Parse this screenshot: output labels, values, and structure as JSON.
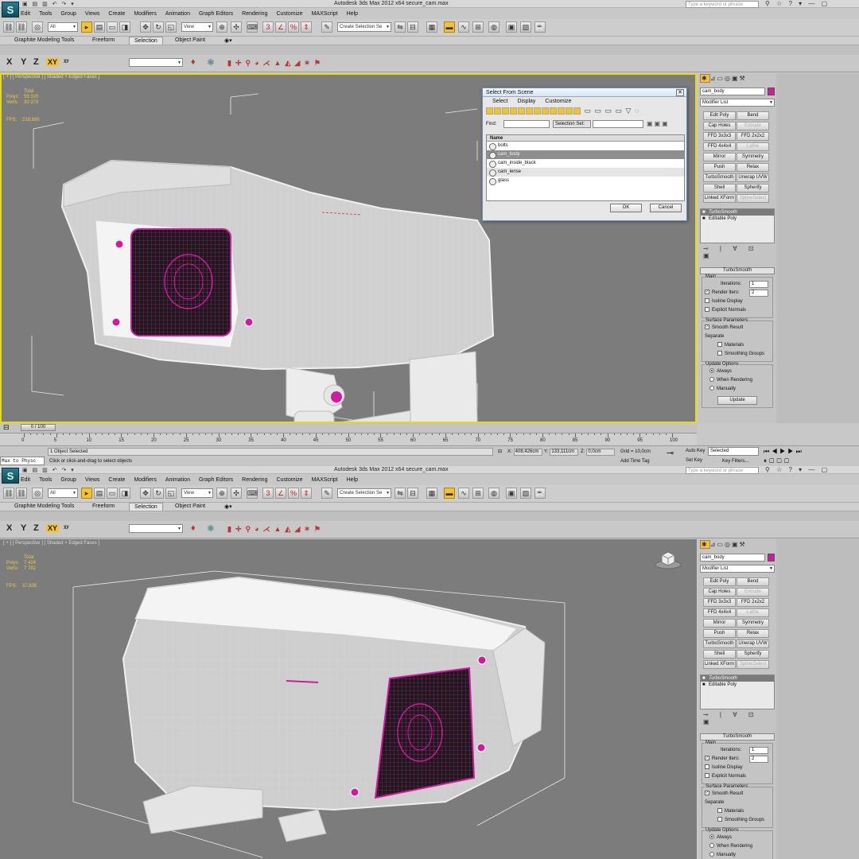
{
  "app": {
    "title": "Autodesk 3ds Max  2012 x64     secure_cam.max",
    "search_placeholder": "Type a keyword or phrase",
    "logo_glyph": "S"
  },
  "menu": [
    "Edit",
    "Tools",
    "Group",
    "Views",
    "Create",
    "Modifiers",
    "Animation",
    "Graph Editors",
    "Rendering",
    "Customize",
    "MAXScript",
    "Help"
  ],
  "toolbar": {
    "filter": "All",
    "refcoord": "View",
    "named_selection": "Create Selection Se"
  },
  "ribbon": {
    "tabs": [
      "Graphite Modeling Tools",
      "Freeform",
      "Selection",
      "Object Paint"
    ],
    "active": "Selection"
  },
  "axis": [
    "X",
    "Y",
    "Z",
    "XY"
  ],
  "viewport1": {
    "label": "[ + ] [ Perspective ] [ Shaded + Edged Faces ]",
    "total_label": "Total",
    "polys_label": "Polys:",
    "polys": "59 320",
    "verts_label": "Verts:",
    "verts": "30 379",
    "fps_label": "FPS:",
    "fps": "218,685"
  },
  "viewport2": {
    "label": "[ + ] [ Perspective ] [ Shaded + Edged Faces ]",
    "total_label": "Total",
    "polys_label": "Polys:",
    "polys": "7 424",
    "verts_label": "Verts:",
    "verts": "7 782",
    "fps_label": "FPS:",
    "fps": "37,635"
  },
  "command_panel": {
    "object_name": "cam_body",
    "modifier_list": "Modifier List",
    "modifier_buttons": [
      {
        "label": "Edit Poly",
        "disabled": false
      },
      {
        "label": "Bend",
        "disabled": false
      },
      {
        "label": "Cap Holes",
        "disabled": false
      },
      {
        "label": "Extrude",
        "disabled": true
      },
      {
        "label": "FFD 3x3x3",
        "disabled": false
      },
      {
        "label": "FFD 2x2x2",
        "disabled": false
      },
      {
        "label": "FFD 4x4x4",
        "disabled": false
      },
      {
        "label": "Lathe",
        "disabled": true
      },
      {
        "label": "Mirror",
        "disabled": false
      },
      {
        "label": "Symmetry",
        "disabled": false
      },
      {
        "label": "Push",
        "disabled": false
      },
      {
        "label": "Relax",
        "disabled": false
      },
      {
        "label": "TurboSmooth",
        "disabled": false
      },
      {
        "label": "Unwrap UVW",
        "disabled": false
      },
      {
        "label": "Shell",
        "disabled": false
      },
      {
        "label": "Spherify",
        "disabled": false
      },
      {
        "label": "Linked XForm",
        "disabled": false
      },
      {
        "label": "SplineSelect",
        "disabled": true
      }
    ],
    "stack": [
      "TurboSmooth",
      "Editable Poly"
    ],
    "rollout_title": "TurboSmooth",
    "main_group": "Main",
    "iterations_label": "Iterations:",
    "iterations": "1",
    "render_iters_label": "Render Iters:",
    "render_iters": "2",
    "isoline": "Isoline Display",
    "explicit": "Explicit Normals",
    "surface_group": "Surface Parameters",
    "smooth_result": "Smooth Result",
    "separate": "Separate",
    "materials": "Materials",
    "smoothing_groups": "Smoothing Groups",
    "update_group": "Update Options",
    "always": "Always",
    "when_rendering": "When Rendering",
    "manually": "Manually",
    "update_btn": "Update"
  },
  "dialog": {
    "title": "Select From Scene",
    "menu": [
      "Select",
      "Display",
      "Customize"
    ],
    "find_label": "Find:",
    "selection_set_label": "Selection Set:",
    "column": "Name",
    "items": [
      "bolts",
      "cam_body",
      "cam_inside_black",
      "cam_lense",
      "glass"
    ],
    "selected": "cam_body",
    "ok": "OK",
    "cancel": "Cancel"
  },
  "timeline": {
    "slider": "0 / 100",
    "ticks": [
      "0",
      "5",
      "10",
      "15",
      "20",
      "25",
      "30",
      "35",
      "40",
      "45",
      "50",
      "55",
      "60",
      "65",
      "70",
      "75",
      "80",
      "85",
      "90",
      "95",
      "100"
    ]
  },
  "status": {
    "maxscript": "Max to Physc",
    "line1": "1 Object Selected",
    "line2": "Click or click-and-drag to select objects",
    "x_label": "X:",
    "x": "408,426cm",
    "y_label": "Y:",
    "y": "133,111cm",
    "z_label": "Z:",
    "z": "0,0cm",
    "grid": "Grid = 10,0cm",
    "add_time_tag": "Add Time Tag",
    "auto_key": "Auto Key",
    "set_key": "Set Key",
    "selected": "Selected",
    "key_filters": "Key Filters..."
  },
  "colors": {
    "viewport_bg": "#7c7c7c",
    "active_border": "#e6d81a",
    "wire_magenta": "#d01aa0",
    "stats_text": "#e8c84a"
  }
}
